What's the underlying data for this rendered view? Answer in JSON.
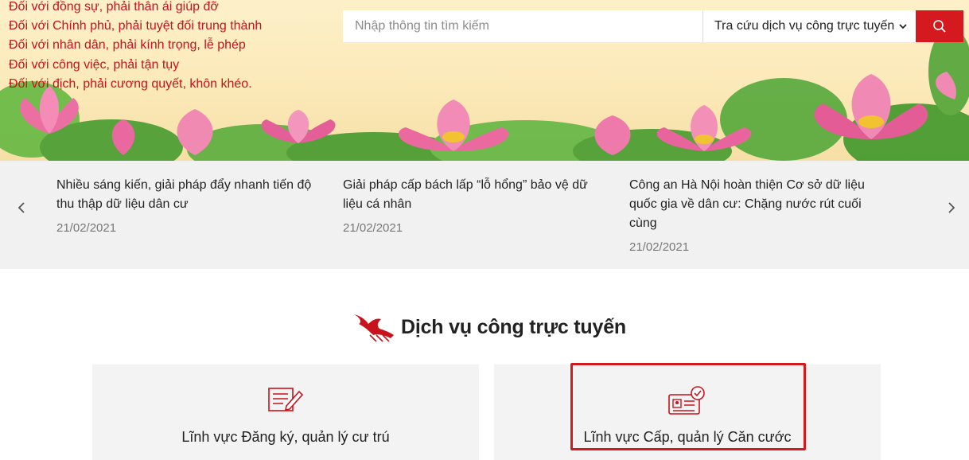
{
  "slogans": [
    "Đối với đồng sự, phải thân ái giúp đỡ",
    "Đối với Chính phủ, phải tuyệt đối trung thành",
    "Đối với nhân dân, phải kính trọng, lễ phép",
    "Đối với công việc, phải tận tụy",
    "Đối với địch, phải cương quyết, khôn khéo."
  ],
  "search": {
    "placeholder": "Nhập thông tin tìm kiếm",
    "select_value": "Tra cứu dịch vụ công trực tuyến"
  },
  "news": [
    {
      "title": "Nhiều sáng kiến, giải pháp đẩy nhanh tiến độ thu thập dữ liệu dân cư",
      "date": "21/02/2021"
    },
    {
      "title": "Giải pháp cấp bách lấp “lỗ hổng” bảo vệ dữ liệu cá nhân",
      "date": "21/02/2021"
    },
    {
      "title": "Công an Hà Nội hoàn thiện Cơ sở dữ liệu quốc gia về dân cư: Chặng nước rút cuối cùng",
      "date": "21/02/2021"
    }
  ],
  "services": {
    "title": "Dịch vụ công trực tuyến",
    "cards": [
      {
        "label": "Lĩnh vực Đăng ký, quản lý cư trú",
        "icon": "document-edit-icon"
      },
      {
        "label": "Lĩnh vực Cấp, quản lý Căn cước",
        "icon": "id-card-check-icon"
      }
    ]
  },
  "colors": {
    "accent": "#d51a1f",
    "slogan": "#c8131c",
    "news_bg": "#f1f1f1",
    "card_bg": "#f3f3f3"
  }
}
